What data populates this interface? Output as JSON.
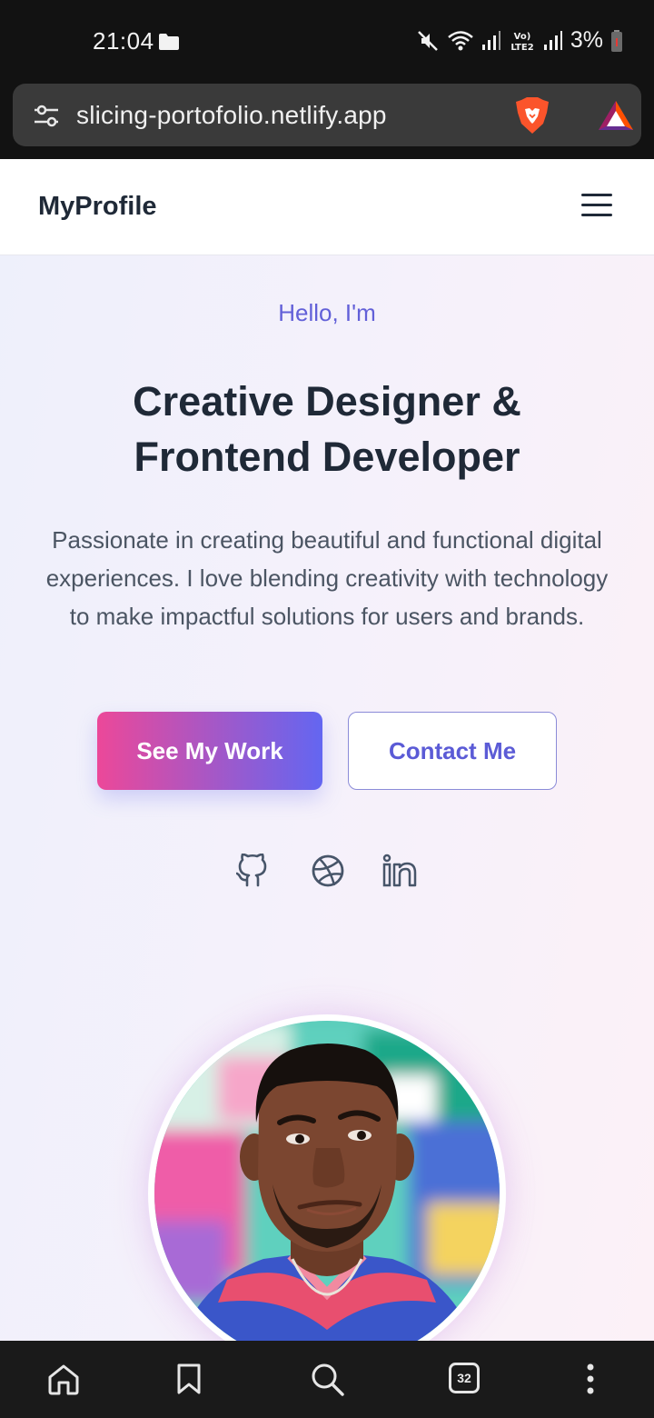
{
  "status_bar": {
    "time": "21:04",
    "battery": "3%",
    "icons": [
      "folder-icon",
      "mute-icon",
      "wifi-icon",
      "signal-icon",
      "volte-icon",
      "signal-icon",
      "battery-icon"
    ]
  },
  "browser": {
    "url": "slicing-portofolio.netlify.app",
    "tab_count": "32",
    "icons": [
      "tune-icon",
      "brave-lion-icon",
      "bat-rewards-icon",
      "home-icon",
      "bookmark-icon",
      "search-icon",
      "tabs-icon",
      "more-icon"
    ]
  },
  "site": {
    "brand": "MyProfile",
    "hero": {
      "greeting": "Hello, I'm",
      "title_line1": "Creative Designer &",
      "title_line2": "Frontend Developer",
      "description": "Passionate in creating beautiful and functional digital experiences. I love blending creativity with technology to make impactful solutions for users and brands.",
      "primary_button": "See My Work",
      "secondary_button": "Contact Me"
    },
    "socials": [
      "github-icon",
      "dribbble-icon",
      "linkedin-icon"
    ]
  },
  "colors": {
    "accent": "#6366f1",
    "pink": "#ec4899",
    "heading": "#1f2937",
    "body_text": "#4b5563"
  }
}
